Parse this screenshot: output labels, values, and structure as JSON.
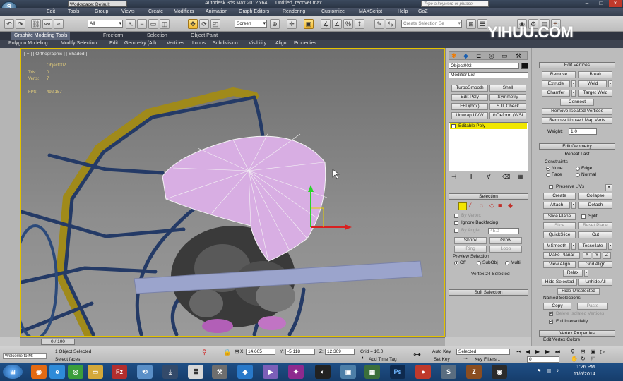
{
  "titlebar": {
    "workspace": "Workspace: Default",
    "app_title": "Autodesk 3ds Max 2012 x64",
    "file_name": "Untitled_recover.max",
    "search_placeholder": "Type a keyword or phrase"
  },
  "menu": [
    "Edit",
    "Tools",
    "Group",
    "Views",
    "Create",
    "Modifiers",
    "Animation",
    "Graph Editors",
    "Rendering",
    "Customize",
    "MAXScript",
    "Help",
    "GoZ"
  ],
  "toolbar": {
    "filter_value": "All",
    "refcoord_value": "Screen",
    "named_selection_placeholder": "Create Selection Se"
  },
  "ribbon": {
    "tabs": [
      "Graphite Modeling Tools",
      "Freeform",
      "Selection",
      "Object Paint"
    ],
    "sub_items": [
      "Polygon Modeling",
      "Modify Selection",
      "Edit",
      "Geometry (All)",
      "Vertices",
      "Loops",
      "Subdivision",
      "Visibility",
      "Align",
      "Properties"
    ]
  },
  "viewport": {
    "label": "[ + ] [ Orthographic ] [ Shaded ]",
    "stats_object": "Object002",
    "stats_rows": [
      {
        "label": "Tris:",
        "value": "0"
      },
      {
        "label": "Verts:",
        "value": "7"
      },
      {
        "label": "FPS:",
        "value": "492.157"
      }
    ]
  },
  "command_panel": {
    "object_name": "Object002",
    "modifier_list": "Modifier List",
    "modifier_buttons": [
      "TurboSmooth",
      "Shell",
      "Edit Poly",
      "Symmetry",
      "FFD(box)",
      "STL Check",
      "Unwrap UVW",
      "thDeform (WSI"
    ],
    "stack_item": "Editable Poly",
    "selection_rollout": "Selection",
    "by_vertex": "By Vertex",
    "ignore_backfacing": "Ignore Backfacing",
    "by_angle": "By Angle:",
    "by_angle_value": "45.0",
    "shrink": "Shrink",
    "grow": "Grow",
    "ring": "Ring",
    "loop": "Loop",
    "preview_selection": "Preview Selection",
    "preview_options": [
      "Off",
      "SubObj",
      "Multi"
    ],
    "status_text": "Vertex 24 Selected",
    "soft_selection": "Soft Selection"
  },
  "right_panel": {
    "edit_vertices": "Edit Vertices",
    "remove": "Remove",
    "break": "Break",
    "extrude": "Extrude",
    "weld": "Weld",
    "chamfer": "Chamfer",
    "target_weld": "Target Weld",
    "connect": "Connect",
    "remove_isolated": "Remove Isolated Vertices",
    "remove_unused": "Remove Unused Map Verts",
    "weight_label": "Weight:",
    "weight_value": "1.0",
    "edit_geometry": "Edit Geometry",
    "repeat_last": "Repeat Last",
    "constraints": "Constraints",
    "constraint_options": [
      "None",
      "Edge",
      "Face",
      "Normal"
    ],
    "preserve_uvs": "Preserve UVs",
    "create": "Create",
    "collapse": "Collapse",
    "attach": "Attach",
    "detach": "Detach",
    "slice_plane": "Slice Plane",
    "split": "Split",
    "slice": "Slice",
    "reset_plane": "Reset Plane",
    "quickslice": "QuickSlice",
    "cut": "Cut",
    "msmooth": "MSmooth",
    "tessellate": "Tessellate",
    "make_planar": "Make Planar",
    "axes": [
      "X",
      "Y",
      "Z"
    ],
    "view_align": "View Align",
    "grid_align": "Grid Align",
    "relax": "Relax",
    "hide_selected": "Hide Selected",
    "unhide_all": "Unhide All",
    "hide_unselected": "Hide Unselected",
    "named_selections": "Named Selections:",
    "copy": "Copy",
    "paste": "Paste",
    "delete_isolated": "Delete Isolated Vertices",
    "full_interactivity": "Full Interactivity",
    "vertex_properties": "Vertex Properties",
    "edit_vertex_colors": "Edit Vertex Colors"
  },
  "timeline": {
    "frame": "0 / 100"
  },
  "status": {
    "selected": "1 Object Selected",
    "prompt": "Select faces",
    "x_label": "X:",
    "x_value": "14.605",
    "y_label": "Y:",
    "y_value": "-5.118",
    "z_label": "Z:",
    "z_value": "12.309",
    "grid": "Grid = 10.0",
    "add_time_tag": "Add Time Tag",
    "auto_key": "Auto Key",
    "auto_key_value": "Selected",
    "set_key": "Set Key",
    "key_filters": "Key Filters...",
    "frame_field": "0"
  },
  "maxscript": {
    "text": "Welcome to M:"
  },
  "taskbar": {
    "time": "1:26 PM",
    "date": "11/6/2014"
  },
  "watermark": "YIHUU.COM"
}
